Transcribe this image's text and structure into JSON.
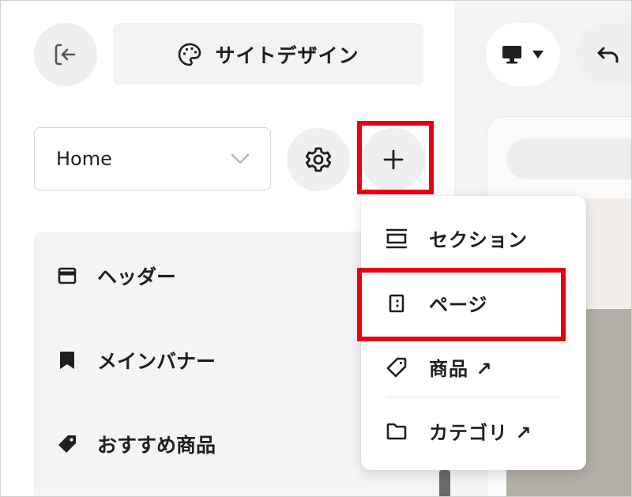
{
  "toolbar": {
    "design_label": "サイトデザイン"
  },
  "page_select": {
    "value": "Home"
  },
  "sections": [
    {
      "label": "ヘッダー",
      "icon": "header-icon"
    },
    {
      "label": "メインバナー",
      "icon": "bookmark-icon"
    },
    {
      "label": "おすすめ商品",
      "icon": "tag-icon"
    }
  ],
  "add_menu": {
    "items": [
      {
        "label": "セクション",
        "icon": "section-icon"
      },
      {
        "label": "ページ",
        "icon": "page-icon"
      },
      {
        "label": "商品 ↗",
        "icon": "tag-outline-icon"
      },
      {
        "label": "カテゴリ ↗",
        "icon": "folder-icon"
      }
    ]
  },
  "colors": {
    "highlight": "#e60012",
    "panel_bg": "#f3f4f6",
    "button_bg": "#efefef"
  }
}
